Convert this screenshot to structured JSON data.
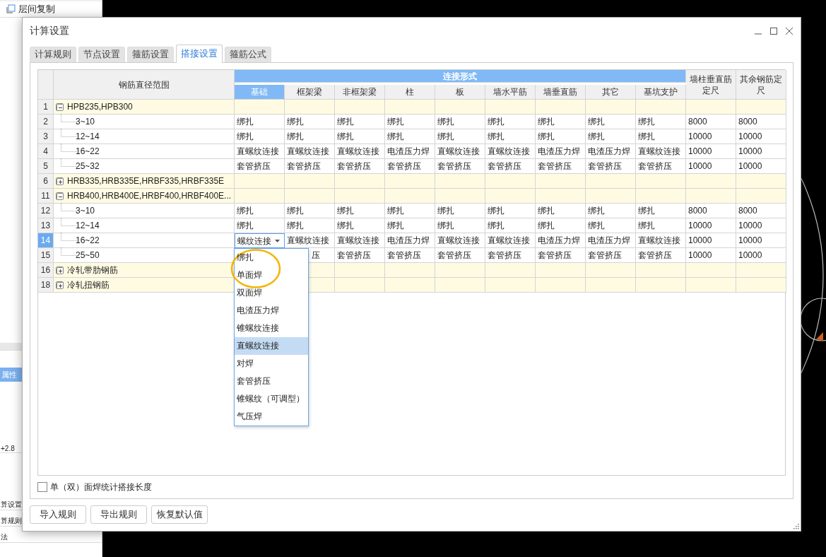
{
  "background": {
    "panel_title": "层间复制",
    "panel_header": "属性",
    "fragments": [
      "+2.8",
      "算设置",
      "算规则",
      "法"
    ]
  },
  "dialog": {
    "title": "计算设置",
    "tabs": [
      {
        "label": "计算规则",
        "selected": false
      },
      {
        "label": "节点设置",
        "selected": false
      },
      {
        "label": "箍筋设置",
        "selected": false
      },
      {
        "label": "搭接设置",
        "selected": true
      },
      {
        "label": "箍筋公式",
        "selected": false
      }
    ],
    "table": {
      "name_header": "钢筋直径范围",
      "group_header": "连接形式",
      "connection_columns": [
        {
          "label": "基础",
          "selected": true
        },
        {
          "label": "框架梁",
          "selected": false
        },
        {
          "label": "非框架梁",
          "selected": false
        },
        {
          "label": "柱",
          "selected": false
        },
        {
          "label": "板",
          "selected": false
        },
        {
          "label": "墙水平筋",
          "selected": false
        },
        {
          "label": "墙垂直筋",
          "selected": false
        },
        {
          "label": "其它",
          "selected": false
        },
        {
          "label": "基坑支护",
          "selected": false
        }
      ],
      "extra_columns": [
        "墙柱垂直筋定尺",
        "其余钢筋定尺"
      ],
      "rows": [
        {
          "number": "1",
          "label": "HPB235,HPB300",
          "expanded": true,
          "selected": false,
          "children": [
            {
              "number": "2",
              "label": "3~10",
              "selected": false,
              "cells": [
                "绑扎",
                "绑扎",
                "绑扎",
                "绑扎",
                "绑扎",
                "绑扎",
                "绑扎",
                "绑扎",
                "绑扎",
                "8000",
                "8000"
              ]
            },
            {
              "number": "3",
              "label": "12~14",
              "selected": false,
              "cells": [
                "绑扎",
                "绑扎",
                "绑扎",
                "绑扎",
                "绑扎",
                "绑扎",
                "绑扎",
                "绑扎",
                "绑扎",
                "10000",
                "10000"
              ]
            },
            {
              "number": "4",
              "label": "16~22",
              "selected": false,
              "cells": [
                "直螺纹连接",
                "直螺纹连接",
                "直螺纹连接",
                "电渣压力焊",
                "直螺纹连接",
                "直螺纹连接",
                "电渣压力焊",
                "电渣压力焊",
                "直螺纹连接",
                "10000",
                "10000"
              ]
            },
            {
              "number": "5",
              "label": "25~32",
              "selected": false,
              "cells": [
                "套管挤压",
                "套管挤压",
                "套管挤压",
                "套管挤压",
                "套管挤压",
                "套管挤压",
                "套管挤压",
                "套管挤压",
                "套管挤压",
                "10000",
                "10000"
              ]
            }
          ]
        },
        {
          "number": "6",
          "label": "HRB335,HRB335E,HRBF335,HRBF335E",
          "expanded": false,
          "selected": false
        },
        {
          "number": "11",
          "label": "HRB400,HRB400E,HRBF400,HRBF400E...",
          "expanded": true,
          "selected": false,
          "children": [
            {
              "number": "12",
              "label": "3~10",
              "selected": false,
              "cells": [
                "绑扎",
                "绑扎",
                "绑扎",
                "绑扎",
                "绑扎",
                "绑扎",
                "绑扎",
                "绑扎",
                "绑扎",
                "8000",
                "8000"
              ]
            },
            {
              "number": "13",
              "label": "12~14",
              "selected": false,
              "cells": [
                "绑扎",
                "绑扎",
                "绑扎",
                "绑扎",
                "绑扎",
                "绑扎",
                "绑扎",
                "绑扎",
                "绑扎",
                "10000",
                "10000"
              ]
            },
            {
              "number": "14",
              "label": "16~22",
              "selected": true,
              "cells": [
                {
                  "kind": "editor",
                  "text": "螺纹连接"
                },
                "直螺纹连接",
                "直螺纹连接",
                "电渣压力焊",
                "直螺纹连接",
                "直螺纹连接",
                "电渣压力焊",
                "电渣压力焊",
                "直螺纹连接",
                "10000",
                "10000"
              ]
            },
            {
              "number": "15",
              "label": "25~50",
              "selected": false,
              "cells": [
                null,
                {
                  "kind": "partial",
                  "text": "压"
                },
                "套管挤压",
                "套管挤压",
                "套管挤压",
                "套管挤压",
                "套管挤压",
                "套管挤压",
                "套管挤压",
                "10000",
                "10000"
              ]
            }
          ]
        },
        {
          "number": "16",
          "label": "冷轧带肋钢筋",
          "expanded": false,
          "selected": false
        },
        {
          "number": "18",
          "label": "冷轧扭钢筋",
          "expanded": false,
          "selected": false
        }
      ]
    },
    "dropdown": {
      "items": [
        {
          "label": "绑扎",
          "selected": false
        },
        {
          "label": "单面焊",
          "selected": false
        },
        {
          "label": "双面焊",
          "selected": false
        },
        {
          "label": "电渣压力焊",
          "selected": false
        },
        {
          "label": "锥螺纹连接",
          "selected": false
        },
        {
          "label": "直螺纹连接",
          "selected": true
        },
        {
          "label": "对焊",
          "selected": false
        },
        {
          "label": "套管挤压",
          "selected": false
        },
        {
          "label": "锥螺纹（可调型）",
          "selected": false
        },
        {
          "label": "气压焊",
          "selected": false
        }
      ]
    },
    "checkbox": {
      "label": "单（双）面焊统计搭接长度",
      "checked": false
    },
    "buttons": [
      "导入规则",
      "导出规则",
      "恢复默认值"
    ]
  }
}
